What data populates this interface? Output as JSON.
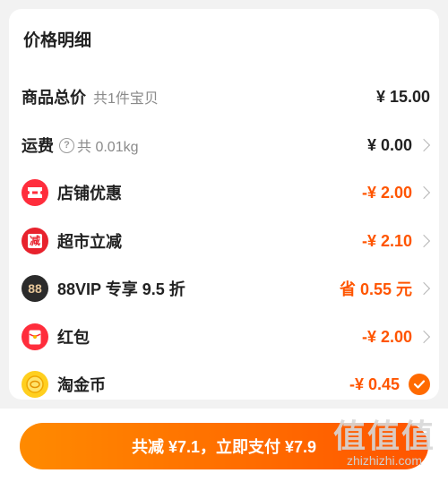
{
  "price_detail": {
    "title": "价格明细",
    "items": [
      {
        "id": "subtotal",
        "label": "商品总价",
        "sub": "共1件宝贝",
        "value": "¥ 15.00",
        "value_color": "#222222",
        "icon": "none",
        "chevron": false
      },
      {
        "id": "shipping",
        "label": "运费",
        "sub": "共 0.01kg",
        "value": "¥ 0.00",
        "value_color": "#222222",
        "icon": "help-icon",
        "chevron": true
      },
      {
        "id": "store_discount",
        "label": "店铺优惠",
        "value": "-¥ 2.00",
        "value_color": "#ff5500",
        "icon": "coupon-ticket-icon",
        "chevron": true
      },
      {
        "id": "supermarket",
        "label": "超市立减",
        "value": "-¥ 2.10",
        "value_color": "#ff5500",
        "icon": "supermarket-reduce-icon",
        "icon_text": "减",
        "chevron": true
      },
      {
        "id": "vip",
        "label": "88VIP 专享 9.5 折",
        "value": "省 0.55 元",
        "value_color": "#ff5500",
        "icon": "88vip-icon",
        "icon_text": "88",
        "chevron": true
      },
      {
        "id": "red_packet",
        "label": "红包",
        "value": "-¥ 2.00",
        "value_color": "#ff5500",
        "icon": "red-packet-icon",
        "chevron": true
      },
      {
        "id": "taojinbi",
        "label": "淘金币",
        "value": "-¥ 0.45",
        "value_color": "#ff5500",
        "icon": "gold-coin-icon",
        "checked": true
      }
    ]
  },
  "footer": {
    "pay_button": "共减 ¥7.1，立即支付 ¥7.9"
  },
  "watermark": {
    "logo": "值值值",
    "url": "zhizhizhi.com"
  }
}
